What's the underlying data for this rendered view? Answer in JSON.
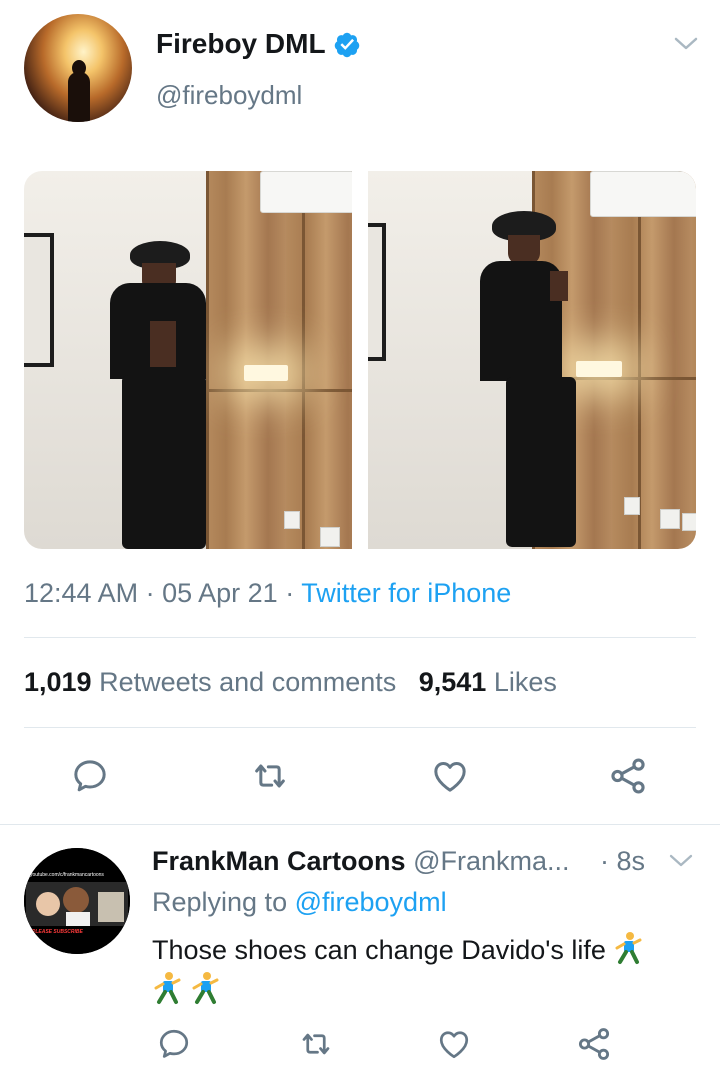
{
  "tweet": {
    "author_name": "Fireboy DML",
    "author_handle": "@fireboydml",
    "time": "12:44 AM",
    "date": "05 Apr 21",
    "separator": "·",
    "source": "Twitter for iPhone",
    "retweets_count": "1,019",
    "retweets_label": "Retweets and comments",
    "likes_count": "9,541",
    "likes_label": "Likes"
  },
  "actions": [
    "reply-icon",
    "retweet-icon",
    "like-icon",
    "share-icon"
  ],
  "reply": {
    "author_name": "FrankMan Cartoons",
    "author_handle": "@Frankma...",
    "time": "· 8s",
    "replying_prefix": "Replying to",
    "replying_to": "@fireboydml",
    "text": "Those shoes can change Davido's life",
    "avatar_banner": "youtube.com/c/frankmancartoons",
    "avatar_subscribe": "PLEASE SUBSCRIBE",
    "emoji_icon": "running-man-emoji"
  },
  "colors": {
    "accent": "#1da1f2",
    "secondary_text": "#657786",
    "primary_text": "#14171a",
    "divider": "#e1e8ed"
  }
}
